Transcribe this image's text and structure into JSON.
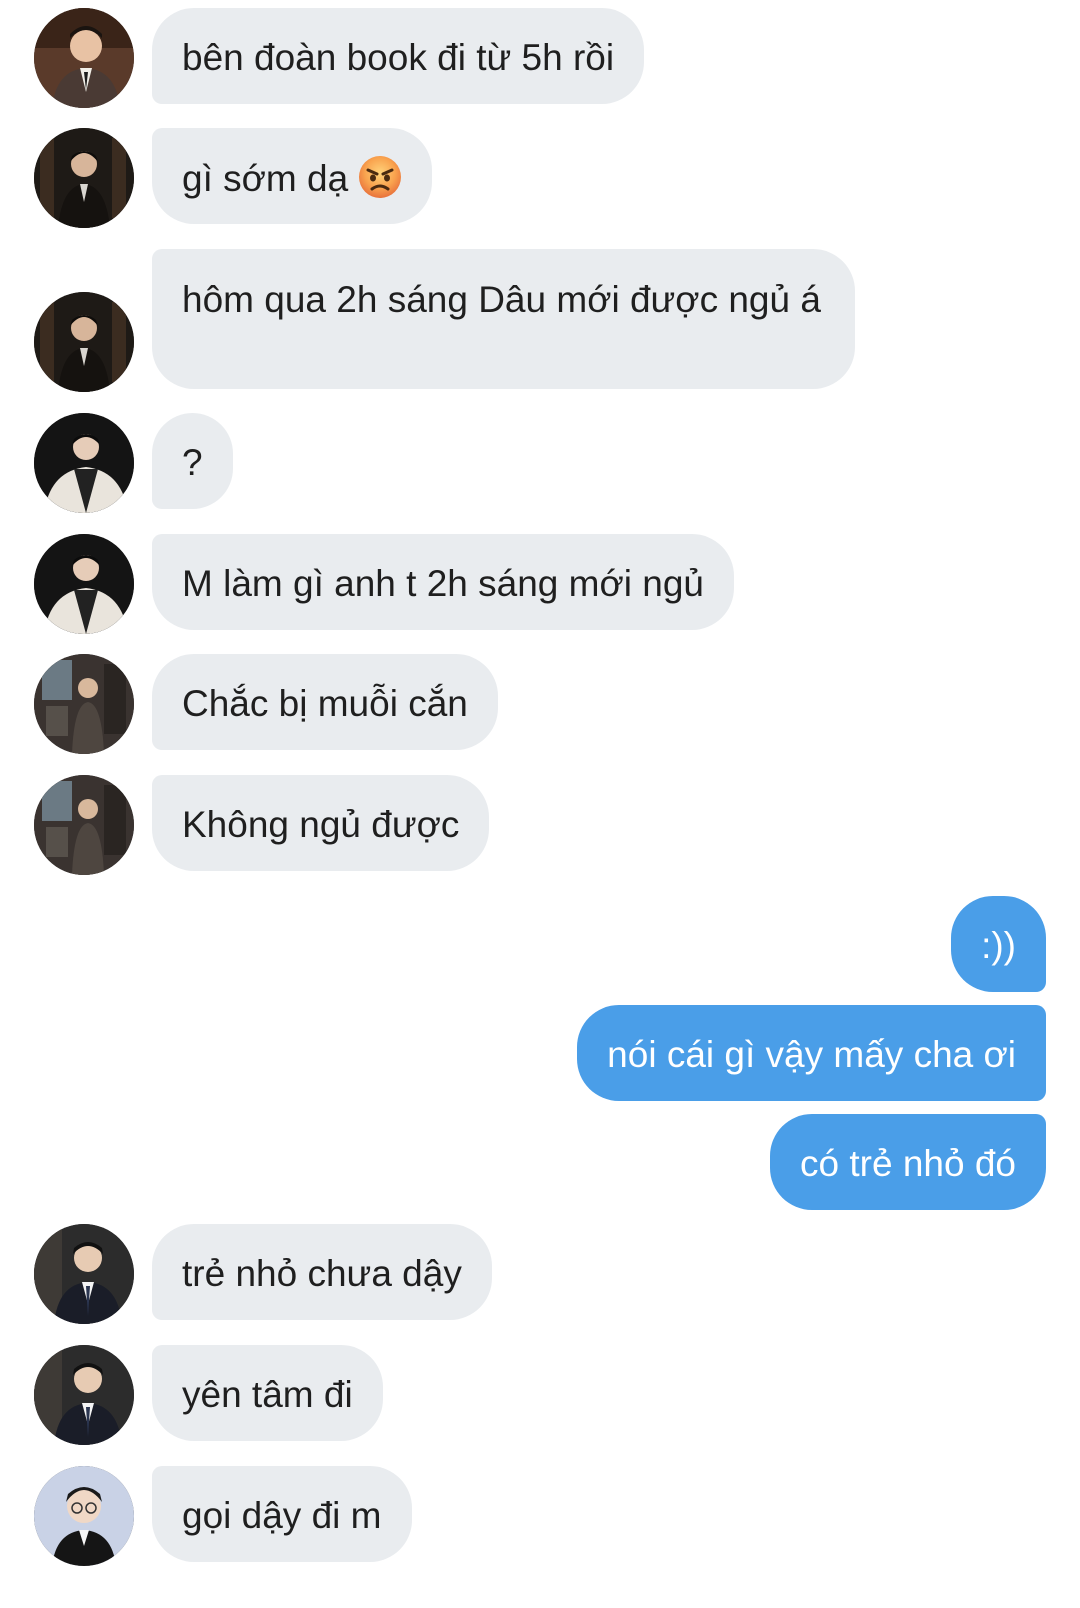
{
  "conversation": {
    "messages": [
      {
        "text": "bên đoàn book đi từ 5h rồi",
        "avatar": "avatar-man-suit-smiling"
      },
      {
        "text": "gì sớm dạ",
        "emoji": "angry-face",
        "avatar": "avatar-man-dark-room"
      },
      {
        "text": "hôm qua 2h sáng Dâu mới được ngủ á",
        "avatar": "avatar-man-dark-room"
      },
      {
        "text": "?",
        "avatar": "avatar-man-white-coat"
      },
      {
        "text": "M làm gì anh t 2h sáng mới ngủ",
        "avatar": "avatar-man-white-coat"
      },
      {
        "text": "Chắc bị muỗi cắn",
        "avatar": "avatar-man-gallery"
      },
      {
        "text": "Không ngủ được",
        "avatar": "avatar-man-gallery"
      },
      {
        "text": ":))",
        "outgoing": true
      },
      {
        "text": "nói cái gì vậy mấy cha ơi",
        "outgoing": true
      },
      {
        "text": "có trẻ nhỏ đó",
        "outgoing": true
      },
      {
        "text": "trẻ nhỏ chưa dậy",
        "avatar": "avatar-man-tie"
      },
      {
        "text": "yên tâm đi",
        "avatar": "avatar-man-tie"
      },
      {
        "text": "gọi dậy đi m",
        "avatar": "avatar-man-glasses"
      }
    ]
  },
  "colors": {
    "incoming_bubble": "#e9ecef",
    "outgoing_bubble": "#4a9ee8",
    "incoming_text": "#1f1f1f",
    "outgoing_text": "#ffffff",
    "background": "#ffffff"
  }
}
